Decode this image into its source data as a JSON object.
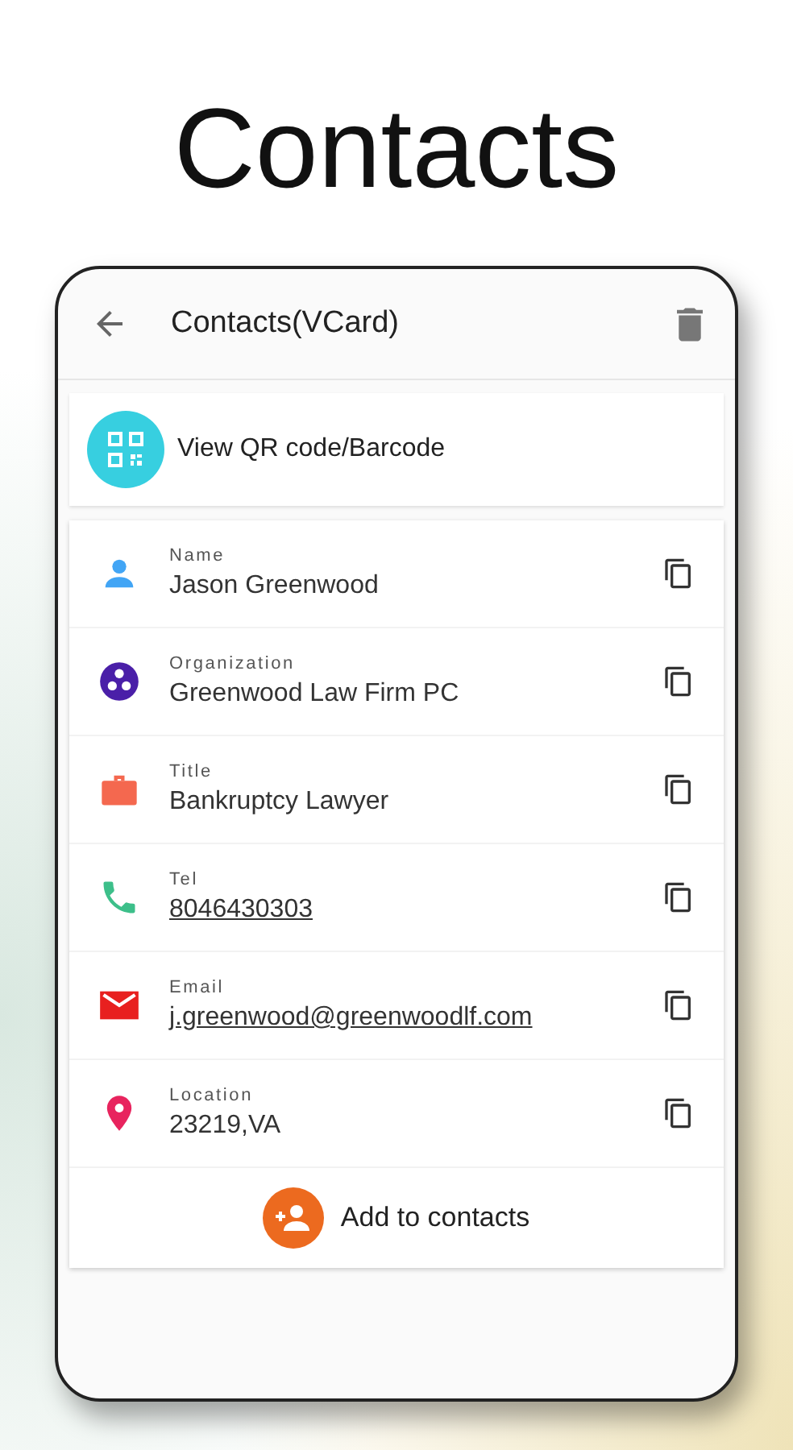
{
  "headline": "Contacts",
  "app_bar": {
    "title": "Contacts(VCard)"
  },
  "qr_card": {
    "label": "View QR code/Barcode"
  },
  "fields": [
    {
      "kind": "name",
      "label": "Name",
      "value": "Jason Greenwood",
      "link": false,
      "color": "#42a5f5"
    },
    {
      "kind": "organization",
      "label": "Organization",
      "value": "Greenwood Law Firm PC",
      "link": false,
      "color": "#4a1fa8"
    },
    {
      "kind": "title",
      "label": "Title",
      "value": "Bankruptcy Lawyer",
      "link": false,
      "color": "#f4684f"
    },
    {
      "kind": "tel",
      "label": "Tel",
      "value": "8046430303",
      "link": true,
      "color": "#3dbf8a"
    },
    {
      "kind": "email",
      "label": "Email",
      "value": "j.greenwood@greenwoodlf.com",
      "link": true,
      "color": "#e8201f"
    },
    {
      "kind": "location",
      "label": "Location",
      "value": "23219,VA",
      "link": false,
      "color": "#e8245e"
    }
  ],
  "add_button": {
    "label": "Add to contacts"
  }
}
